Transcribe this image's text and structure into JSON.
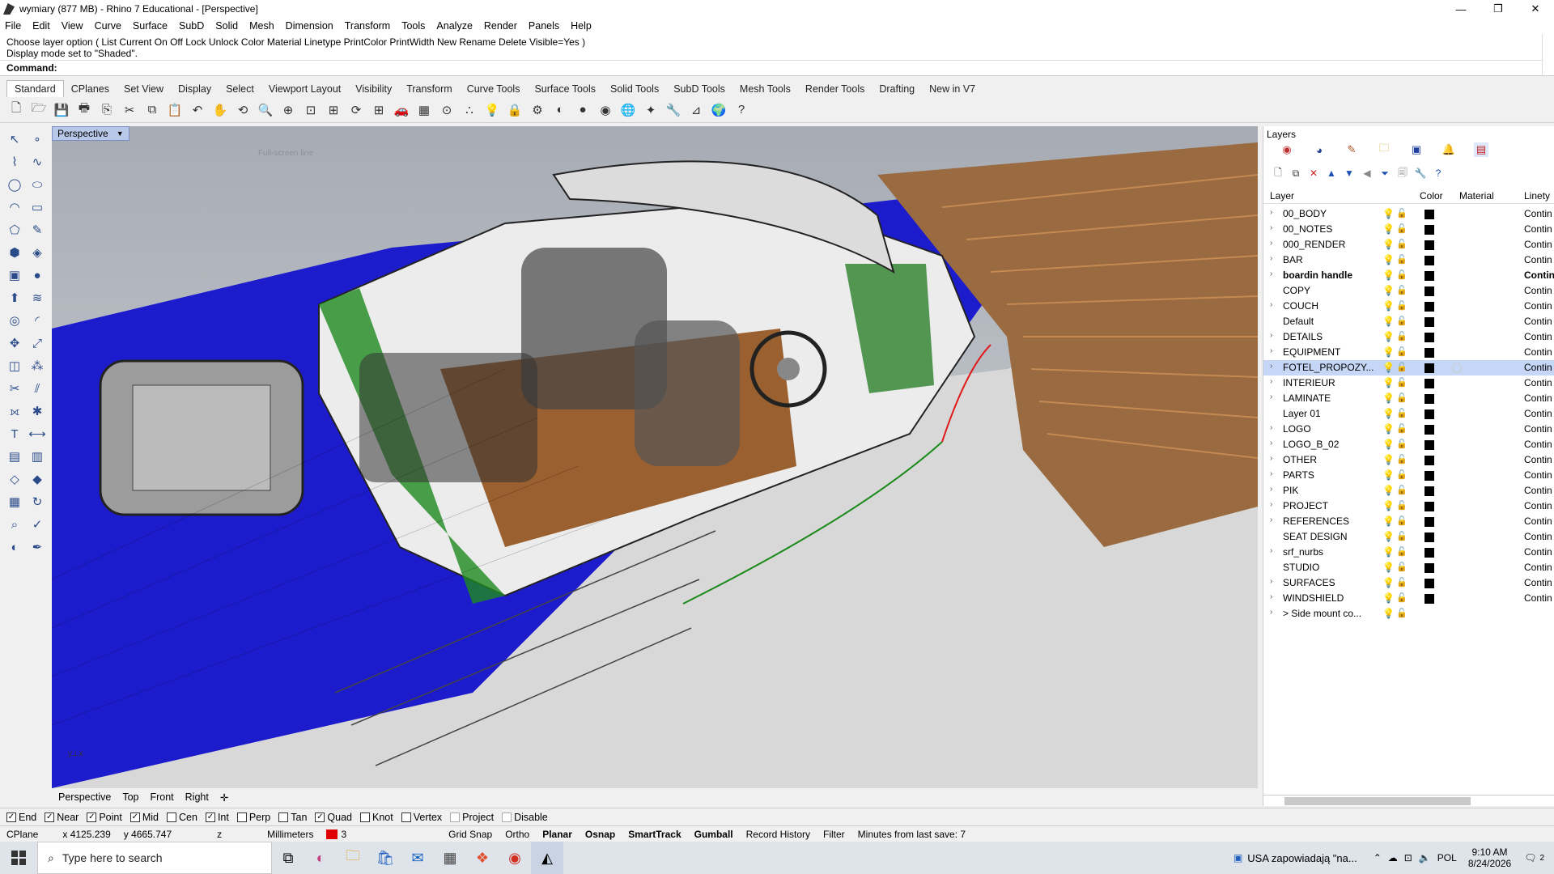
{
  "window": {
    "title": "wymiary (877 MB) - Rhino 7 Educational - [Perspective]",
    "controls": [
      "—",
      "❐",
      "✕"
    ]
  },
  "menu": [
    "File",
    "Edit",
    "View",
    "Curve",
    "Surface",
    "SubD",
    "Solid",
    "Mesh",
    "Dimension",
    "Transform",
    "Tools",
    "Analyze",
    "Render",
    "Panels",
    "Help"
  ],
  "command": {
    "history": [
      "Choose layer option ( List  Current  On  Off  Lock  Unlock  Color  Material  Linetype  PrintColor  PrintWidth  New  Rename  Delete  Visible=Yes )",
      "Display mode set to \"Shaded\"."
    ],
    "prompt": "Command:",
    "value": ""
  },
  "toolbar_tabs": [
    "Standard",
    "CPlanes",
    "Set View",
    "Display",
    "Select",
    "Viewport Layout",
    "Visibility",
    "Transform",
    "Curve Tools",
    "Surface Tools",
    "Solid Tools",
    "SubD Tools",
    "Mesh Tools",
    "Render Tools",
    "Drafting",
    "New in V7"
  ],
  "toolbar_icons": [
    "new-icon",
    "open-icon",
    "save-icon",
    "print-icon",
    "import-icon",
    "cut-icon",
    "copy-icon",
    "paste-icon",
    "undo-icon",
    "pan-icon",
    "rotate-view-icon",
    "zoom-icon",
    "zoom-window-icon",
    "zoom-extents-icon",
    "zoom-selected-icon",
    "rotate-icon",
    "four-viewports-icon",
    "car-icon",
    "grid-icon",
    "cplane-icon",
    "point-icon",
    "light-icon",
    "lock-icon",
    "properties-icon",
    "color-wheel-icon",
    "material-icon",
    "render-icon",
    "sphere-icon",
    "sun-icon",
    "tools-icon",
    "dimension-icon",
    "globe-icon",
    "help-icon"
  ],
  "toolbar_glyphs": [
    "🗋",
    "🗁",
    "💾",
    "🖶",
    "⎘",
    "✂",
    "⧉",
    "📋",
    "↶",
    "✋",
    "⟲",
    "🔍",
    "⊕",
    "⊡",
    "⊞",
    "⟳",
    "⊞",
    "🚗",
    "▦",
    "⊙",
    "∴",
    "💡",
    "🔒",
    "⚙",
    "◐",
    "●",
    "◉",
    "🌐",
    "✦",
    "🔧",
    "⊿",
    "🌍",
    "?"
  ],
  "viewport": {
    "label": "Perspective",
    "caption": "Full-screen line"
  },
  "viewport_tabs": [
    "Perspective",
    "Top",
    "Front",
    "Right",
    "✛"
  ],
  "osnaps": [
    {
      "label": "End",
      "checked": true
    },
    {
      "label": "Near",
      "checked": true
    },
    {
      "label": "Point",
      "checked": true
    },
    {
      "label": "Mid",
      "checked": true
    },
    {
      "label": "Cen",
      "checked": false
    },
    {
      "label": "Int",
      "checked": true
    },
    {
      "label": "Perp",
      "checked": false
    },
    {
      "label": "Tan",
      "checked": false
    },
    {
      "label": "Quad",
      "checked": true
    },
    {
      "label": "Knot",
      "checked": false
    },
    {
      "label": "Vertex",
      "checked": false
    },
    {
      "label": "Project",
      "checked": false
    },
    {
      "label": "Disable",
      "checked": false
    }
  ],
  "status": {
    "cplane": "CPlane",
    "x": "x 4125.239",
    "y": "y 4665.747",
    "z": "z",
    "units": "Millimeters",
    "layer": "3",
    "grid_snap": "Grid Snap",
    "ortho": "Ortho",
    "planar": "Planar",
    "osnap": "Osnap",
    "smarttrack": "SmartTrack",
    "gumball": "Gumball",
    "record_history": "Record History",
    "filter": "Filter",
    "last_save": "Minutes from last save: 7",
    "layer_color": "#e00000"
  },
  "layers_panel": {
    "title": "Layers",
    "columns": {
      "layer": "Layer",
      "color": "Color",
      "material": "Material",
      "linetype": "Linety"
    },
    "rows": [
      {
        "name": "00_BODY",
        "lt": "Contin",
        "exp": true
      },
      {
        "name": "00_NOTES",
        "lt": "Contin",
        "exp": true
      },
      {
        "name": "000_RENDER",
        "lt": "Contin",
        "exp": true
      },
      {
        "name": "BAR",
        "lt": "Contin",
        "exp": true
      },
      {
        "name": "boardin handle",
        "lt": "Contin",
        "exp": true,
        "bold": true
      },
      {
        "name": "COPY",
        "lt": "Contin",
        "exp": false
      },
      {
        "name": "COUCH",
        "lt": "Contin",
        "exp": true
      },
      {
        "name": "Default",
        "lt": "Contin",
        "exp": false
      },
      {
        "name": "DETAILS",
        "lt": "Contin",
        "exp": true
      },
      {
        "name": "EQUIPMENT",
        "lt": "Contin",
        "exp": true
      },
      {
        "name": "FOTEL_PROPOZY...",
        "lt": "Contin",
        "exp": true,
        "selected": true
      },
      {
        "name": "INTERIEUR",
        "lt": "Contin",
        "exp": true
      },
      {
        "name": "LAMINATE",
        "lt": "Contin",
        "exp": true
      },
      {
        "name": "Layer 01",
        "lt": "Contin",
        "exp": false
      },
      {
        "name": "LOGO",
        "lt": "Contin",
        "exp": true
      },
      {
        "name": "LOGO_B_02",
        "lt": "Contin",
        "exp": true
      },
      {
        "name": "OTHER",
        "lt": "Contin",
        "exp": true
      },
      {
        "name": "PARTS",
        "lt": "Contin",
        "exp": true
      },
      {
        "name": "PIK",
        "lt": "Contin",
        "exp": true
      },
      {
        "name": "PROJECT",
        "lt": "Contin",
        "exp": true
      },
      {
        "name": "REFERENCES",
        "lt": "Contin",
        "exp": true
      },
      {
        "name": "SEAT DESIGN",
        "lt": "Contin",
        "exp": false
      },
      {
        "name": "srf_nurbs",
        "lt": "Contin",
        "exp": true
      },
      {
        "name": "STUDIO",
        "lt": "Contin",
        "exp": false
      },
      {
        "name": "SURFACES",
        "lt": "Contin",
        "exp": true
      },
      {
        "name": "WINDSHIELD",
        "lt": "Contin",
        "exp": true
      },
      {
        "name": "> Side mount co...",
        "lt": "",
        "exp": true,
        "nocolor": true
      }
    ]
  },
  "taskbar": {
    "search_placeholder": "Type here to search",
    "news": "USA zapowiadają \"na...",
    "lang": "POL",
    "time": "9:10 AM",
    "date": "8/24/2026",
    "notif": "2"
  }
}
